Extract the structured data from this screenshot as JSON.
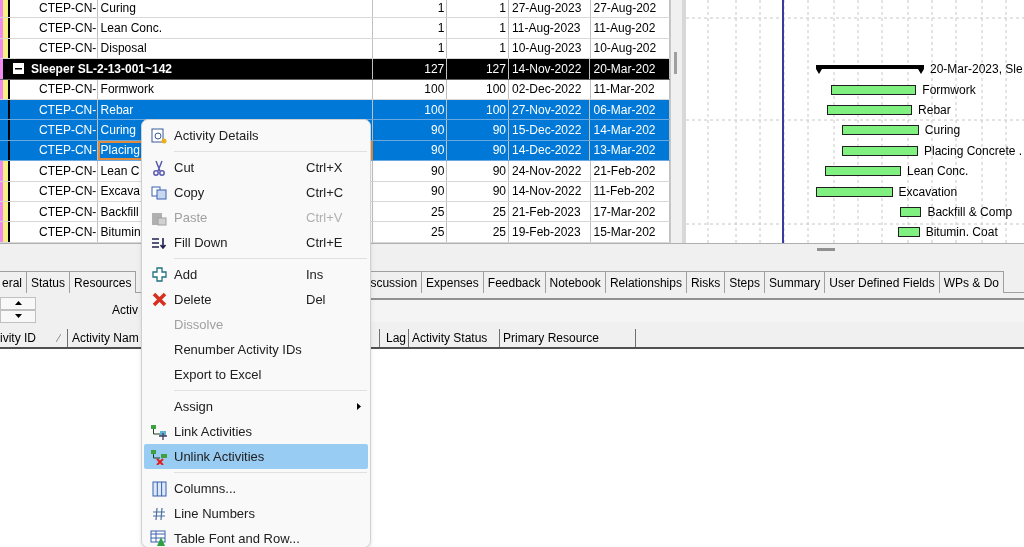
{
  "activity_table": {
    "rows": [
      {
        "kind": "activity",
        "selected": false,
        "focused_cell": false,
        "activity_id": "CTEP-CN-",
        "activity_name": "Curing",
        "column_3": "1",
        "column_4": "1",
        "column_5": "27-Aug-2023",
        "column_6": "27-Aug-202"
      },
      {
        "kind": "activity",
        "selected": false,
        "focused_cell": false,
        "activity_id": "CTEP-CN-",
        "activity_name": "Lean Conc.",
        "column_3": "1",
        "column_4": "1",
        "column_5": "11-Aug-2023",
        "column_6": "11-Aug-202"
      },
      {
        "kind": "activity",
        "selected": false,
        "focused_cell": false,
        "activity_id": "CTEP-CN-",
        "activity_name": "Disposal",
        "column_3": "1",
        "column_4": "1",
        "column_5": "10-Aug-2023",
        "column_6": "10-Aug-202"
      },
      {
        "kind": "wbs",
        "expanded": true,
        "selected": false,
        "activity_name": "Sleeper SL-2-13-001~142",
        "column_3": "127",
        "column_4": "127",
        "column_5": "14-Nov-2022",
        "column_6": "20-Mar-202",
        "bar_label": "20-Mar-2023, Sle"
      },
      {
        "kind": "activity",
        "selected": false,
        "focused_cell": false,
        "activity_id": "CTEP-CN-",
        "activity_name": "Formwork",
        "column_3": "100",
        "column_4": "100",
        "column_5": "02-Dec-2022",
        "column_6": "11-Mar-202",
        "bar_label": "Formwork"
      },
      {
        "kind": "activity",
        "selected": true,
        "focused_cell": false,
        "activity_id": "CTEP-CN-",
        "activity_name": "Rebar",
        "column_3": "100",
        "column_4": "100",
        "column_5": "27-Nov-2022",
        "column_6": "06-Mar-202",
        "bar_label": "Rebar"
      },
      {
        "kind": "activity",
        "selected": true,
        "focused_cell": false,
        "activity_id": "CTEP-CN-",
        "activity_name": "Curing",
        "column_3": "90",
        "column_4": "90",
        "column_5": "15-Dec-2022",
        "column_6": "14-Mar-202",
        "bar_label": "Curing"
      },
      {
        "kind": "activity",
        "selected": true,
        "focused_cell": true,
        "activity_id": "CTEP-CN-",
        "activity_name": "Placing",
        "column_3": "90",
        "column_4": "90",
        "column_5": "14-Dec-2022",
        "column_6": "13-Mar-202",
        "bar_label": "Placing Concrete ."
      },
      {
        "kind": "activity",
        "selected": false,
        "focused_cell": false,
        "activity_id": "CTEP-CN-",
        "activity_name": "Lean C",
        "column_3": "90",
        "column_4": "90",
        "column_5": "24-Nov-2022",
        "column_6": "21-Feb-202",
        "bar_label": "Lean Conc."
      },
      {
        "kind": "activity",
        "selected": false,
        "focused_cell": false,
        "activity_id": "CTEP-CN-",
        "activity_name": "Excava",
        "column_3": "90",
        "column_4": "90",
        "column_5": "14-Nov-2022",
        "column_6": "11-Feb-202",
        "bar_label": "Excavation"
      },
      {
        "kind": "activity",
        "selected": false,
        "focused_cell": false,
        "activity_id": "CTEP-CN-",
        "activity_name": "Backfill",
        "column_3": "25",
        "column_4": "25",
        "column_5": "21-Feb-2023",
        "column_6": "17-Mar-202",
        "bar_label": "Backfill & Comp"
      },
      {
        "kind": "activity",
        "selected": false,
        "focused_cell": false,
        "activity_id": "CTEP-CN-",
        "activity_name": "Bitumin",
        "column_3": "25",
        "column_4": "25",
        "column_5": "19-Feb-2023",
        "column_6": "15-Mar-202",
        "bar_label": "Bitumin. Coat"
      }
    ]
  },
  "detail_tabs": [
    {
      "label": "eral",
      "selected": false
    },
    {
      "label": "Status",
      "selected": false
    },
    {
      "label": "Resources",
      "selected": false
    },
    {
      "label": "scussion",
      "selected": false
    },
    {
      "label": "Expenses",
      "selected": false
    },
    {
      "label": "Feedback",
      "selected": false
    },
    {
      "label": "Notebook",
      "selected": false
    },
    {
      "label": "Relationships",
      "selected": false
    },
    {
      "label": "Risks",
      "selected": false
    },
    {
      "label": "Steps",
      "selected": false
    },
    {
      "label": "Summary",
      "selected": false
    },
    {
      "label": "User Defined Fields",
      "selected": false
    },
    {
      "label": "WPs & Do",
      "selected": false
    }
  ],
  "detail_panel": {
    "activity_label": "Activ"
  },
  "relationship_columns": [
    "ivity ID",
    "Activity Nam",
    "Lag",
    "Activity Status",
    "Primary Resource"
  ],
  "context_menu": {
    "items": [
      {
        "kind": "item",
        "label": "Activity Details",
        "selected": false,
        "disabled": false
      },
      {
        "kind": "separator"
      },
      {
        "kind": "item",
        "label": "Cut",
        "shortcut": "Ctrl+X",
        "selected": false,
        "disabled": false
      },
      {
        "kind": "item",
        "label": "Copy",
        "shortcut": "Ctrl+C",
        "selected": false,
        "disabled": false
      },
      {
        "kind": "item",
        "label": "Paste",
        "shortcut": "Ctrl+V",
        "selected": false,
        "disabled": true
      },
      {
        "kind": "item",
        "label": "Fill Down",
        "shortcut": "Ctrl+E",
        "selected": false,
        "disabled": false
      },
      {
        "kind": "separator"
      },
      {
        "kind": "item",
        "label": "Add",
        "shortcut": "Ins",
        "selected": false,
        "disabled": false
      },
      {
        "kind": "item",
        "label": "Delete",
        "shortcut": "Del",
        "selected": false,
        "disabled": false
      },
      {
        "kind": "item",
        "label": "Dissolve",
        "selected": false,
        "disabled": true
      },
      {
        "kind": "item",
        "label": "Renumber Activity IDs",
        "selected": false,
        "disabled": false
      },
      {
        "kind": "item",
        "label": "Export to Excel",
        "selected": false,
        "disabled": false
      },
      {
        "kind": "separator"
      },
      {
        "kind": "item",
        "label": "Assign",
        "submenu": true,
        "selected": false,
        "disabled": false
      },
      {
        "kind": "item",
        "label": "Link Activities",
        "selected": false,
        "disabled": false
      },
      {
        "kind": "item",
        "label": "Unlink Activities",
        "selected": true,
        "disabled": false
      },
      {
        "kind": "separator"
      },
      {
        "kind": "item",
        "label": "Columns...",
        "selected": false,
        "disabled": false
      },
      {
        "kind": "item",
        "label": "Line Numbers",
        "selected": false,
        "disabled": false
      },
      {
        "kind": "item",
        "label": "Table Font and Row...",
        "selected": false,
        "disabled": false
      }
    ]
  }
}
